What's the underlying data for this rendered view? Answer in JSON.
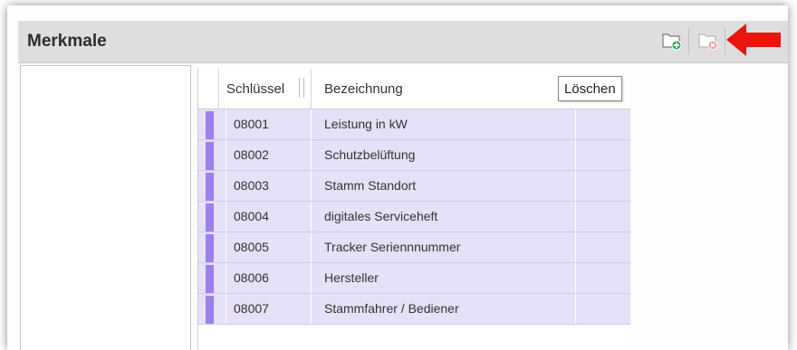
{
  "panel": {
    "title": "Merkmale"
  },
  "toolbar": {
    "add_icon": "folder-add-icon",
    "delete_icon": "folder-delete-icon",
    "annotation": "red-arrow-icon",
    "colors": {
      "add_badge": "#2faa46",
      "delete_badge": "#e8a09a",
      "arrow": "#e8160c"
    }
  },
  "grid": {
    "columns": {
      "key": "Schlüssel",
      "name": "Bezeichnung",
      "delete": "Löschen"
    },
    "rows": [
      {
        "key": "08001",
        "name": "Leistung in kW"
      },
      {
        "key": "08002",
        "name": "Schutzbelüftung"
      },
      {
        "key": "08003",
        "name": "Stamm Standort"
      },
      {
        "key": "08004",
        "name": "digitales Serviceheft"
      },
      {
        "key": "08005",
        "name": "Tracker Seriennnummer"
      },
      {
        "key": "08006",
        "name": "Hersteller"
      },
      {
        "key": "08007",
        "name": "Stammfahrer / Bediener"
      }
    ],
    "colors": {
      "row_bg": "#e6e0f8",
      "indicator": "#9e7ff0"
    }
  }
}
